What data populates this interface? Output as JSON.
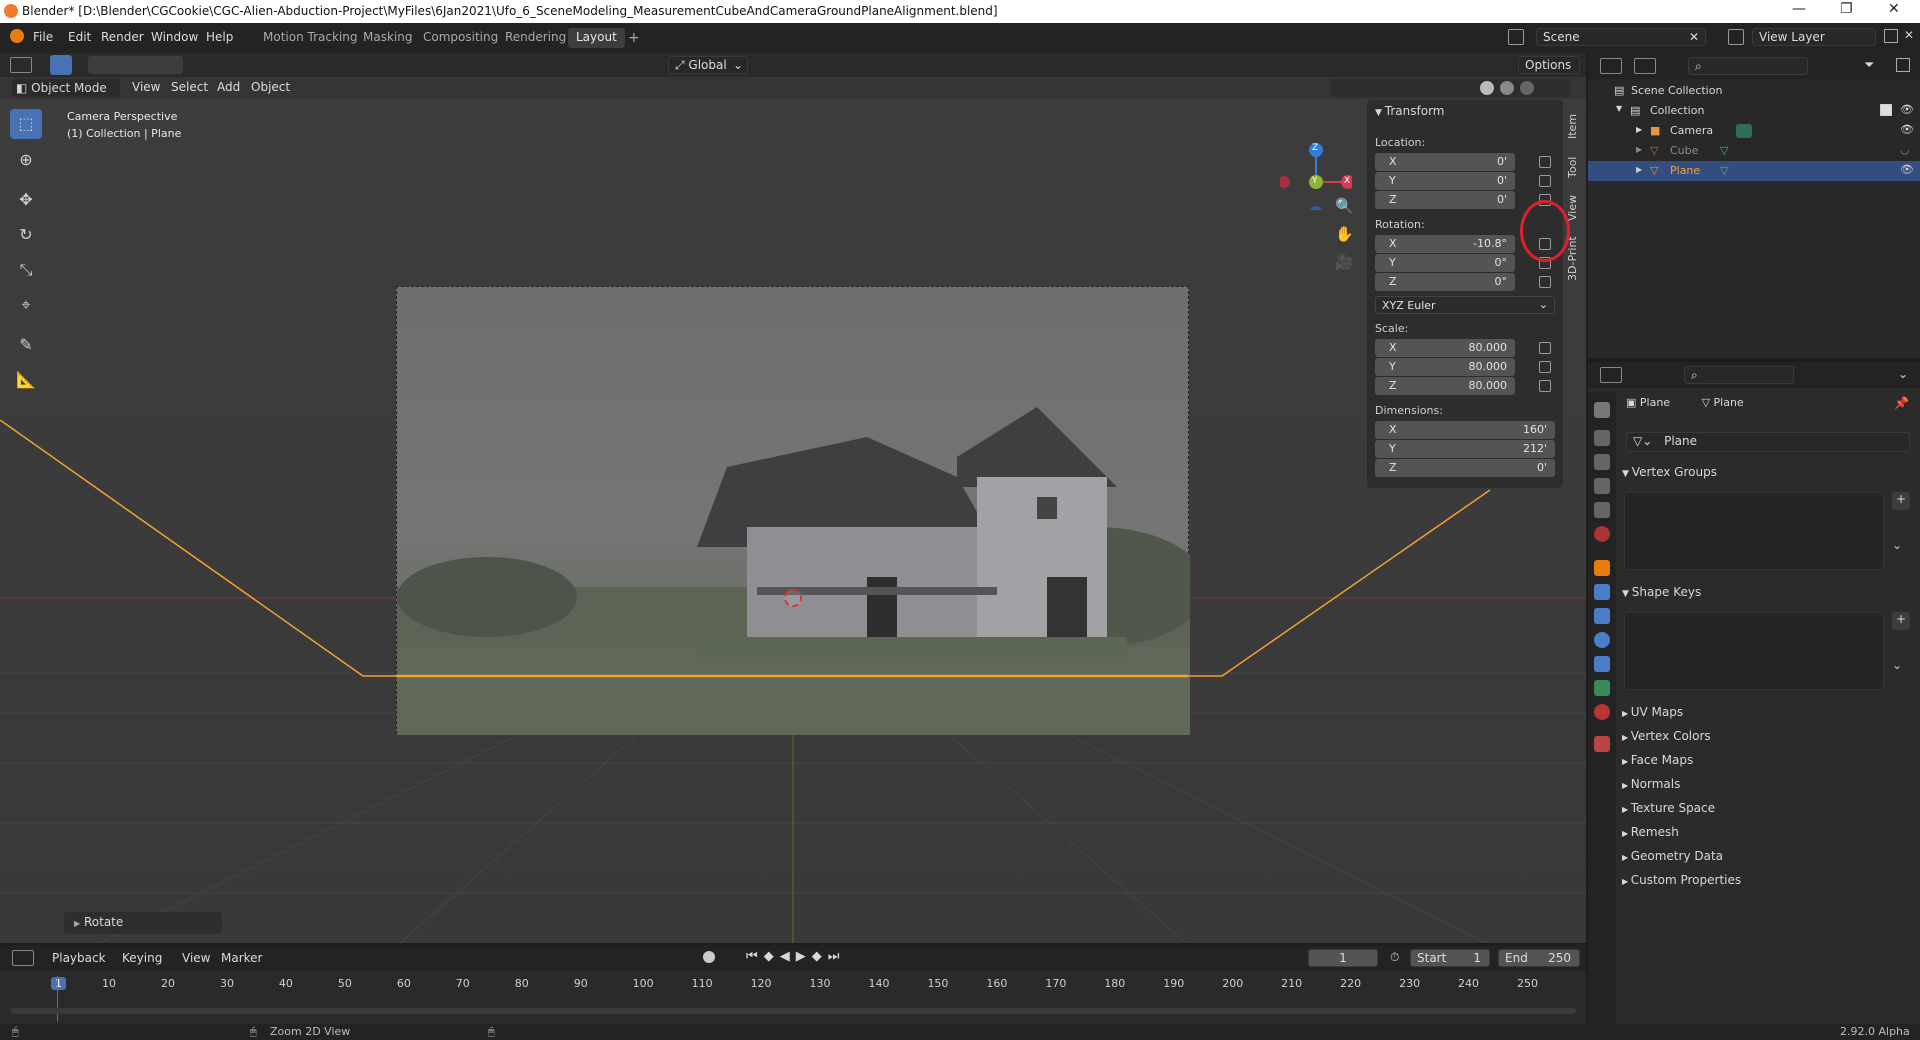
{
  "window": {
    "title": "Blender* [D:\\Blender\\CGCookie\\CGC-Alien-Abduction-Project\\MyFiles\\6Jan2021\\Ufo_6_SceneModeling_MeasurementCubeAndCameraGroundPlaneAlignment.blend]",
    "minimize": "—",
    "maximize": "❐",
    "close": "✕"
  },
  "menu": [
    "File",
    "Edit",
    "Render",
    "Window",
    "Help"
  ],
  "workspaces": [
    {
      "label": "Motion Tracking",
      "active": false
    },
    {
      "label": "Masking",
      "active": false
    },
    {
      "label": "Compositing",
      "active": false
    },
    {
      "label": "Rendering",
      "active": false
    },
    {
      "label": "Layout",
      "active": true
    }
  ],
  "add_workspace": "+",
  "scene_field": "Scene",
  "view_layer_field": "View Layer",
  "viewport_header": {
    "mode": "Object Mode",
    "menus": [
      "View",
      "Select",
      "Add",
      "Object"
    ],
    "transform_orientation": "Global",
    "options": "Options"
  },
  "overlay_text": {
    "line1": "Camera Perspective",
    "line2": "(1) Collection | Plane"
  },
  "last_op": "Rotate",
  "gizmo": {
    "x": "X",
    "y": "Y",
    "z": "Z"
  },
  "npanel": {
    "header": "Transform",
    "location_label": "Location:",
    "location": [
      {
        "axis": "X",
        "value": "0'"
      },
      {
        "axis": "Y",
        "value": "0'"
      },
      {
        "axis": "Z",
        "value": "0'"
      }
    ],
    "rotation_label": "Rotation:",
    "rotation": [
      {
        "axis": "X",
        "value": "-10.8°"
      },
      {
        "axis": "Y",
        "value": "0°"
      },
      {
        "axis": "Z",
        "value": "0°"
      }
    ],
    "rotation_mode": "XYZ Euler",
    "scale_label": "Scale:",
    "scale": [
      {
        "axis": "X",
        "value": "80.000"
      },
      {
        "axis": "Y",
        "value": "80.000"
      },
      {
        "axis": "Z",
        "value": "80.000"
      }
    ],
    "dimensions_label": "Dimensions:",
    "dimensions": [
      {
        "axis": "X",
        "value": "160'"
      },
      {
        "axis": "Y",
        "value": "212'"
      },
      {
        "axis": "Z",
        "value": "0'"
      }
    ],
    "tabs": [
      "Item",
      "Tool",
      "View",
      "3D-Print"
    ]
  },
  "outliner": {
    "scene_collection": "Scene Collection",
    "collection": "Collection",
    "items": [
      {
        "name": "Camera",
        "selected": false
      },
      {
        "name": "Cube",
        "selected": false
      },
      {
        "name": "Plane",
        "selected": true
      }
    ]
  },
  "properties": {
    "object_name": "Plane",
    "data_name": "Plane",
    "mesh_field": "Plane",
    "sections_open": [
      "Vertex Groups",
      "Shape Keys"
    ],
    "sections_closed": [
      "UV Maps",
      "Vertex Colors",
      "Face Maps",
      "Normals",
      "Texture Space",
      "Remesh",
      "Geometry Data",
      "Custom Properties"
    ]
  },
  "timeline": {
    "menus": [
      "Playback",
      "Keying",
      "View",
      "Marker"
    ],
    "current_frame": "1",
    "start_label": "Start",
    "start": "1",
    "end_label": "End",
    "end": "250",
    "ticks": [
      "1",
      "10",
      "20",
      "30",
      "40",
      "50",
      "60",
      "70",
      "80",
      "90",
      "100",
      "110",
      "120",
      "130",
      "140",
      "150",
      "160",
      "170",
      "180",
      "190",
      "200",
      "210",
      "220",
      "230",
      "240",
      "250"
    ]
  },
  "status": {
    "hint": "Zoom 2D View",
    "version": "2.92.0 Alpha"
  },
  "colors": {
    "accent": "#4772b3",
    "selection_orange": "#f5a030",
    "axis_x": "#d33b4e",
    "axis_y": "#8bb637",
    "axis_z": "#2f7fd6"
  }
}
